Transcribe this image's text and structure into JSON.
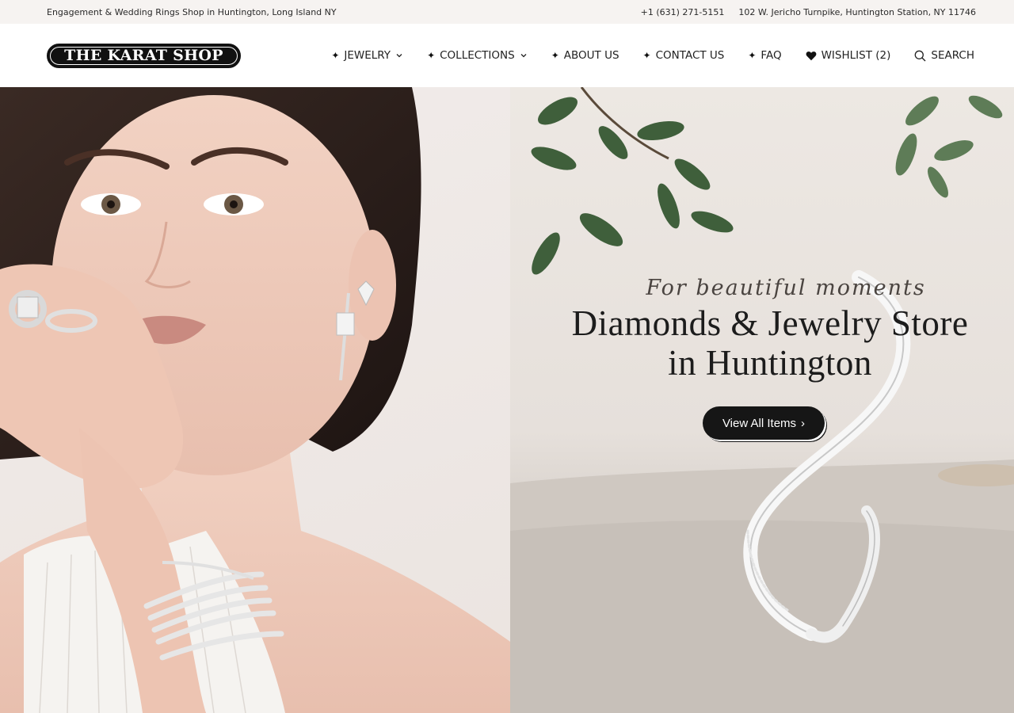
{
  "topbar": {
    "tagline": "Engagement & Wedding Rings Shop in Huntington, Long Island NY",
    "phone": "+1 (631) 271-5151",
    "address": "102 W. Jericho Turnpike, Huntington Station, NY 11746"
  },
  "header": {
    "logo_text": "THE KARAT SHOP",
    "nav": {
      "jewelry": "JEWELRY",
      "collections": "COLLECTIONS",
      "about": "ABOUT US",
      "contact": "CONTACT US",
      "faq": "FAQ",
      "wishlist": "WISHLIST (2)",
      "search": "SEARCH"
    }
  },
  "hero": {
    "script_text": "For beautiful moments",
    "headline_line1": "Diamonds & Jewelry Store",
    "headline_line2": "in Huntington",
    "cta_label": "View All Items",
    "cta_arrow": "›"
  }
}
